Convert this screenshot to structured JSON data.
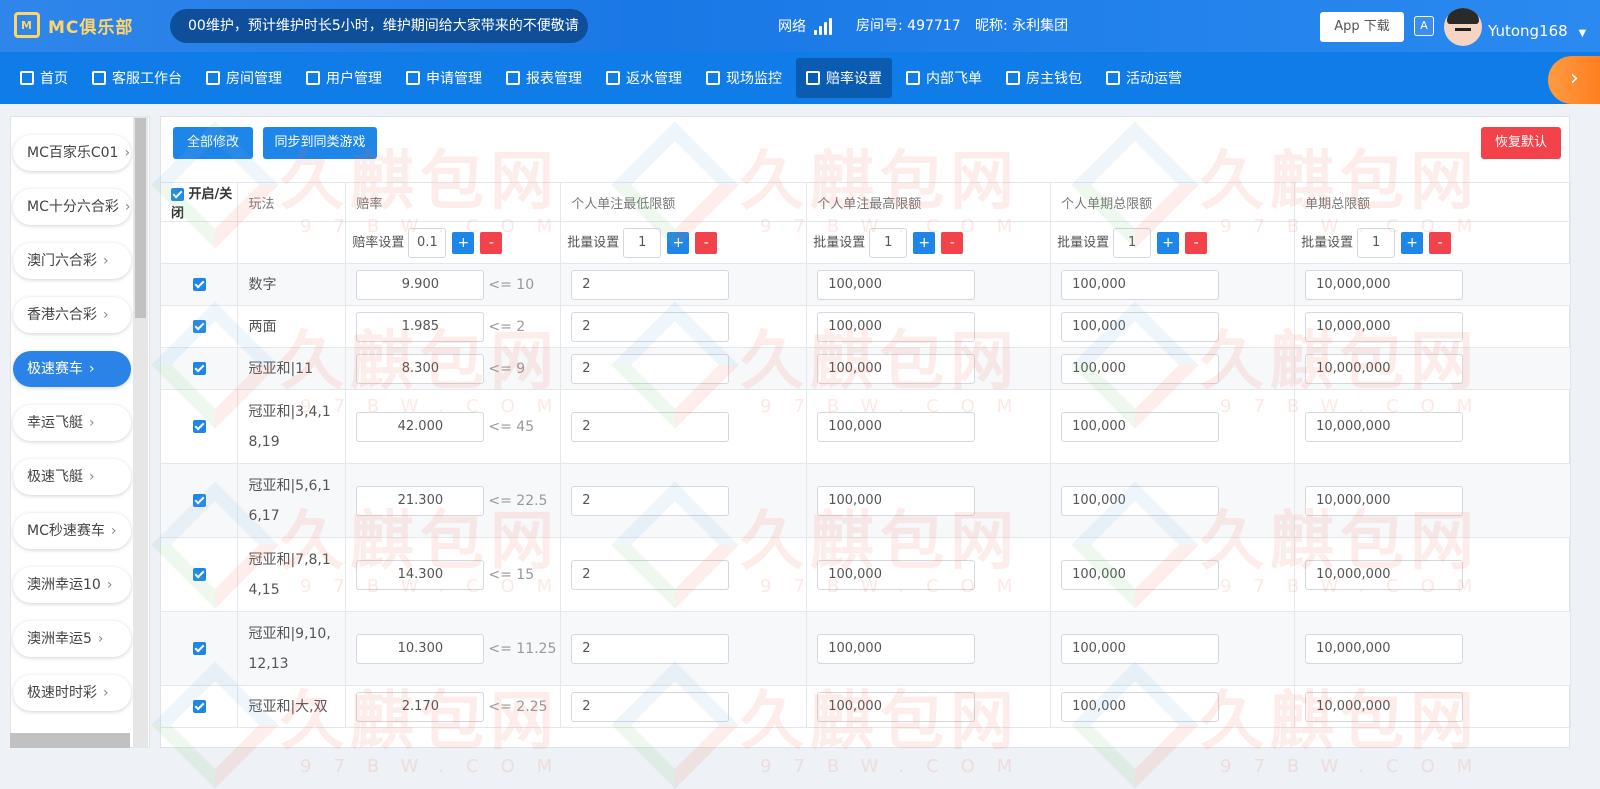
{
  "header": {
    "logo_text": "MC俱乐部",
    "notice": "00维护，预计维护时长5小时，维护期间给大家带来的不便敬请",
    "network_label": "网络",
    "room_label": "房间号: 497717",
    "nickname_label": "昵称: 永利集团",
    "app_download": "App 下载",
    "username": "Yutong168",
    "lang_icon": "translate-icon"
  },
  "nav": {
    "items": [
      {
        "label": "首页",
        "icon": "home-icon"
      },
      {
        "label": "客服工作台",
        "icon": "headset-icon"
      },
      {
        "label": "房间管理",
        "icon": "grid-icon"
      },
      {
        "label": "用户管理",
        "icon": "user-icon"
      },
      {
        "label": "申请管理",
        "icon": "document-icon"
      },
      {
        "label": "报表管理",
        "icon": "bar-chart-icon"
      },
      {
        "label": "返水管理",
        "icon": "tag-icon"
      },
      {
        "label": "现场监控",
        "icon": "monitor-icon"
      },
      {
        "label": "赔率设置",
        "icon": "yen-shield-icon"
      },
      {
        "label": "内部飞单",
        "icon": "refresh-icon"
      },
      {
        "label": "房主钱包",
        "icon": "wallet-icon"
      },
      {
        "label": "活动运营",
        "icon": "gift-icon"
      }
    ],
    "active_index": 8
  },
  "sidebar": {
    "items": [
      "MC百家乐C01",
      "MC十分六合彩",
      "澳门六合彩",
      "香港六合彩",
      "极速赛车",
      "幸运飞艇",
      "极速飞艇",
      "MC秒速赛车",
      "澳洲幸运10",
      "澳洲幸运5",
      "极速时时彩"
    ],
    "active_index": 4
  },
  "toolbar": {
    "modify_all": "全部修改",
    "sync_same": "同步到同类游戏",
    "restore_default": "恢复默认"
  },
  "table": {
    "headers": {
      "toggle": "开启/关闭",
      "play": "玩法",
      "odds": "赔率",
      "min_single": "个人单注最低限额",
      "max_single": "个人单注最高限额",
      "period_total": "个人单期总限额",
      "single_period_total": "单期总限额"
    },
    "batch": {
      "odds_label": "赔率设置",
      "odds_value": "0.1",
      "batch_label": "批量设置",
      "batch_value": "1",
      "plus": "+",
      "minus": "-"
    },
    "rows": [
      {
        "play": "数字",
        "odds": "9.900",
        "limit": "<= 10",
        "min": "2",
        "max": "100,000",
        "period": "100,000",
        "total": "10,000,000"
      },
      {
        "play": "两面",
        "odds": "1.985",
        "limit": "<= 2",
        "min": "2",
        "max": "100,000",
        "period": "100,000",
        "total": "10,000,000"
      },
      {
        "play": "冠亚和|11",
        "odds": "8.300",
        "limit": "<= 9",
        "min": "2",
        "max": "100,000",
        "period": "100,000",
        "total": "10,000,000"
      },
      {
        "play": "冠亚和|3,4,18,19",
        "odds": "42.000",
        "limit": "<= 45",
        "min": "2",
        "max": "100,000",
        "period": "100,000",
        "total": "10,000,000"
      },
      {
        "play": "冠亚和|5,6,16,17",
        "odds": "21.300",
        "limit": "<= 22.5",
        "min": "2",
        "max": "100,000",
        "period": "100,000",
        "total": "10,000,000"
      },
      {
        "play": "冠亚和|7,8,14,15",
        "odds": "14.300",
        "limit": "<= 15",
        "min": "2",
        "max": "100,000",
        "period": "100,000",
        "total": "10,000,000"
      },
      {
        "play": "冠亚和|9,10,12,13",
        "odds": "10.300",
        "limit": "<= 11.25",
        "min": "2",
        "max": "100,000",
        "period": "100,000",
        "total": "10,000,000"
      },
      {
        "play": "冠亚和|大,双",
        "odds": "2.170",
        "limit": "<= 2.25",
        "min": "2",
        "max": "100,000",
        "period": "100,000",
        "total": "10,000,000"
      }
    ]
  },
  "watermark": {
    "text": "久麒包网",
    "sub": "97BW.COM"
  }
}
